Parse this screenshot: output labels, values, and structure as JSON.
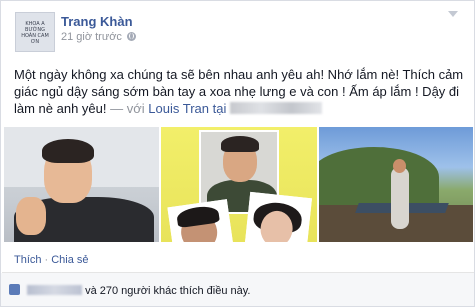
{
  "header": {
    "author_name": "Trang Khàn",
    "timestamp": "21 giờ trước",
    "avatar_text": "KHOA A BƯỚNG HOÀN CAM ƠN",
    "privacy_icon": "globe-icon",
    "menu_icon": "chevron-down-icon"
  },
  "post": {
    "text": "Một ngày không xa chúng ta sẽ bên nhau anh yêu ah! Nhớ lắm nè! Thích cảm giác ngủ dậy sáng sớm bàn tay a xoa nhẹ lưng e và con ! Ấm áp lắm ! Dậy đi làm nè anh yêu!",
    "with_prefix": "— với",
    "tagged_person": "Louis Tran",
    "location_prefix": "tại"
  },
  "photos": [
    {
      "alt": "man-portrait"
    },
    {
      "alt": "collage"
    },
    {
      "alt": "outdoor-deck"
    }
  ],
  "actions": {
    "like_label": "Thích",
    "separator": "·",
    "share_label": "Chia sẻ"
  },
  "likes": {
    "text": "và 270 người khác thích điều này.",
    "icon": "thumbs-up-icon"
  },
  "colors": {
    "link": "#3b5998",
    "meta": "#90949c",
    "likes_bg": "#f6f7f9"
  }
}
